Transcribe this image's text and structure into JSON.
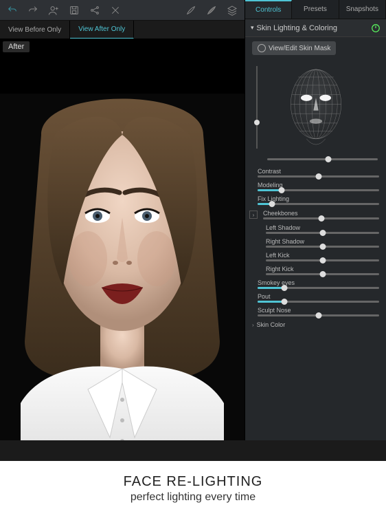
{
  "toolbar": {
    "icons": [
      "undo",
      "redo",
      "add-user",
      "save",
      "share",
      "crop",
      "brush-light",
      "brush-dark",
      "layers"
    ]
  },
  "viewTabs": {
    "items": [
      "View Before Only",
      "View After Only"
    ],
    "activeIndex": 1
  },
  "canvas": {
    "label": "After"
  },
  "rightTabs": {
    "items": [
      "Controls",
      "Presets",
      "Snapshots"
    ],
    "activeIndex": 0
  },
  "panel": {
    "title": "Skin Lighting & Coloring",
    "skinMaskBtn": "View/Edit Skin Mask",
    "faceVSlider": 65,
    "faceHSlider": 55,
    "sliders": [
      {
        "label": "Contrast",
        "value": 50,
        "teal": false,
        "sub": false
      },
      {
        "label": "Modeling",
        "value": 20,
        "teal": true,
        "sub": false
      },
      {
        "label": "Fix Lighting",
        "value": 12,
        "teal": true,
        "sub": false
      }
    ],
    "cheekbones": {
      "label": "Cheekbones",
      "value": 50,
      "subs": [
        {
          "label": "Left Shadow",
          "value": 50
        },
        {
          "label": "Right Shadow",
          "value": 50
        },
        {
          "label": "Left Kick",
          "value": 50
        },
        {
          "label": "Right Kick",
          "value": 50
        }
      ]
    },
    "more": [
      {
        "label": "Smokey eyes",
        "value": 22,
        "teal": true
      },
      {
        "label": "Pout",
        "value": 22,
        "teal": true
      },
      {
        "label": "Sculpt Nose",
        "value": 50,
        "teal": false
      }
    ],
    "skinColorLabel": "Skin Color"
  },
  "caption": {
    "line1": "FACE RE-LIGHTING",
    "line2": "perfect lighting every time"
  },
  "colors": {
    "accent": "#4fc4d4"
  }
}
